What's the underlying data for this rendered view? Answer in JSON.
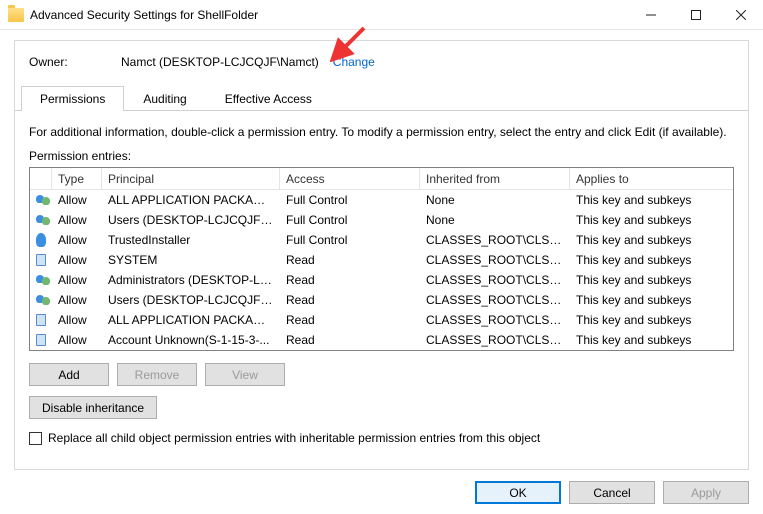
{
  "window": {
    "title": "Advanced Security Settings for ShellFolder"
  },
  "owner": {
    "label": "Owner:",
    "value": "Namct (DESKTOP-LCJCQJF\\Namct)",
    "change": "Change"
  },
  "tabs": {
    "permissions": "Permissions",
    "auditing": "Auditing",
    "effective": "Effective Access"
  },
  "info": "For additional information, double-click a permission entry. To modify a permission entry, select the entry and click Edit (if available).",
  "entries_label": "Permission entries:",
  "columns": {
    "type": "Type",
    "principal": "Principal",
    "access": "Access",
    "inherited": "Inherited from",
    "applies": "Applies to"
  },
  "rows": [
    {
      "icon": "users",
      "type": "Allow",
      "principal": "ALL APPLICATION PACKAGES",
      "access": "Full Control",
      "inherited": "None",
      "applies": "This key and subkeys"
    },
    {
      "icon": "users",
      "type": "Allow",
      "principal": "Users (DESKTOP-LCJCQJF\\Use...",
      "access": "Full Control",
      "inherited": "None",
      "applies": "This key and subkeys"
    },
    {
      "icon": "single",
      "type": "Allow",
      "principal": "TrustedInstaller",
      "access": "Full Control",
      "inherited": "CLASSES_ROOT\\CLSID...",
      "applies": "This key and subkeys"
    },
    {
      "icon": "pc",
      "type": "Allow",
      "principal": "SYSTEM",
      "access": "Read",
      "inherited": "CLASSES_ROOT\\CLSID...",
      "applies": "This key and subkeys"
    },
    {
      "icon": "users",
      "type": "Allow",
      "principal": "Administrators (DESKTOP-LCJ...",
      "access": "Read",
      "inherited": "CLASSES_ROOT\\CLSID...",
      "applies": "This key and subkeys"
    },
    {
      "icon": "users",
      "type": "Allow",
      "principal": "Users (DESKTOP-LCJCQJF\\Use...",
      "access": "Read",
      "inherited": "CLASSES_ROOT\\CLSID...",
      "applies": "This key and subkeys"
    },
    {
      "icon": "pc",
      "type": "Allow",
      "principal": "ALL APPLICATION PACKAGES",
      "access": "Read",
      "inherited": "CLASSES_ROOT\\CLSID...",
      "applies": "This key and subkeys"
    },
    {
      "icon": "pc",
      "type": "Allow",
      "principal": "Account Unknown(S-1-15-3-...",
      "access": "Read",
      "inherited": "CLASSES_ROOT\\CLSID...",
      "applies": "This key and subkeys"
    }
  ],
  "buttons": {
    "add": "Add",
    "remove": "Remove",
    "view": "View",
    "disable_inheritance": "Disable inheritance",
    "ok": "OK",
    "cancel": "Cancel",
    "apply": "Apply"
  },
  "checkbox": {
    "label": "Replace all child object permission entries with inheritable permission entries from this object"
  }
}
